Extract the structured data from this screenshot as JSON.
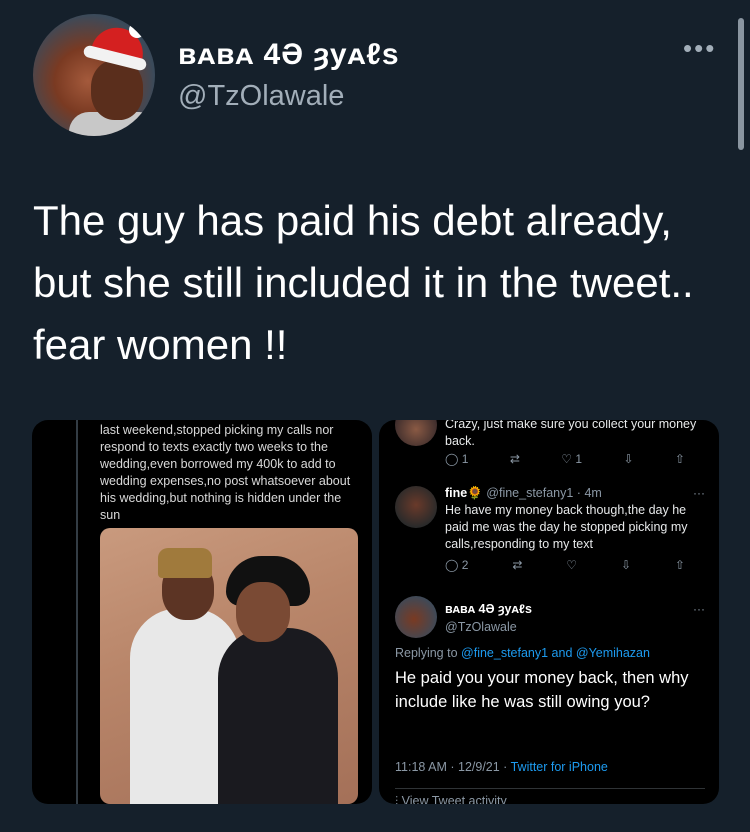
{
  "header": {
    "display_name": "ʙᴀʙᴀ 4Ә ȝyᴀℓs",
    "handle": "@TzOlawale",
    "more_icon": "more-horizontal-icon"
  },
  "tweet": {
    "text": "The guy has paid his debt already, but she still included it in the tweet.. fear women !!"
  },
  "left_screenshot": {
    "text": "last weekend,stopped picking my calls nor respond to texts exactly two weeks to the wedding,even borrowed my 400k to add to wedding expenses,no post whatsoever about his wedding,but nothing is hidden under the sun"
  },
  "right_screenshot": {
    "top_text": "Crazy, just make sure you collect your money back.",
    "top_actions": {
      "replies": "1",
      "likes": "1"
    },
    "reply1": {
      "name": "fine🌻",
      "handle_time": "@fine_stefany1 · 4m",
      "text": "He have my money back though,the day he paid me was the day he stopped picking my calls,responding to my text",
      "replies": "2"
    },
    "reply2": {
      "name": "ʙᴀʙᴀ 4Ә ȝyᴀℓs",
      "handle": "@TzOlawale",
      "replying_prefix": "Replying to",
      "replying_to": "@fine_stefany1 and @Yemihazan",
      "text": "He paid you your money back, then why include like he was still owing you?",
      "time": "11:18 AM · 12/9/21 ·",
      "source": "Twitter for iPhone",
      "activity": "View Tweet activity"
    }
  }
}
